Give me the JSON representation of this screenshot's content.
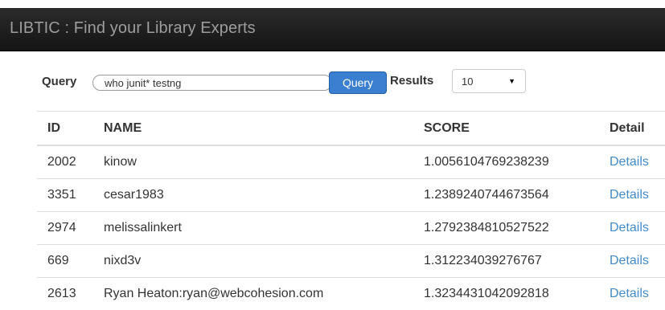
{
  "app": {
    "title": "LIBTIC : Find your Library Experts"
  },
  "search": {
    "query_label": "Query",
    "query_value": "who junit* testng",
    "query_button": "Query",
    "results_label": "Results",
    "results_value": "10"
  },
  "table": {
    "headers": [
      "ID",
      "NAME",
      "SCORE",
      "Detail"
    ],
    "rows": [
      {
        "id": "2002",
        "name": "kinow",
        "score": "1.0056104769238239",
        "detail": "Details"
      },
      {
        "id": "3351",
        "name": "cesar1983",
        "score": "1.2389240744673564",
        "detail": "Details"
      },
      {
        "id": "2974",
        "name": "melissalinkert",
        "score": "1.2792384810527522",
        "detail": "Details"
      },
      {
        "id": "669",
        "name": "nixd3v",
        "score": "1.312234039276767",
        "detail": "Details"
      },
      {
        "id": "2613",
        "name": "Ryan Heaton:ryan@webcohesion.com",
        "score": "1.3234431042092818",
        "detail": "Details"
      }
    ]
  },
  "colors": {
    "navbar": "#1b1b1b",
    "brand_text": "#9d9d9d",
    "primary_button": "#3a7fd0",
    "link": "#428bca"
  }
}
